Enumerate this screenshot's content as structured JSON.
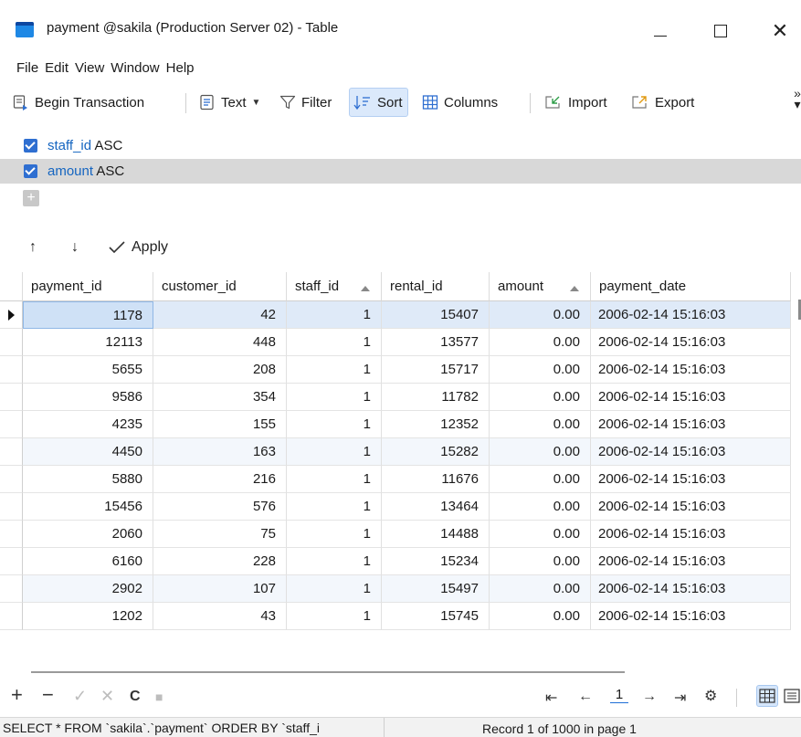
{
  "window": {
    "title": "payment @sakila (Production Server 02) - Table",
    "minimize": "—",
    "maximize": "",
    "close": "✕"
  },
  "menu": [
    "File",
    "Edit",
    "View",
    "Window",
    "Help"
  ],
  "toolbar": {
    "begin_transaction": "Begin Transaction",
    "text": "Text",
    "filter": "Filter",
    "sort": "Sort",
    "columns": "Columns",
    "import": "Import",
    "export": "Export",
    "overflow": "»"
  },
  "sort_panel": {
    "rules": [
      {
        "field": "staff_id",
        "direction": "ASC",
        "checked": true,
        "selected": false
      },
      {
        "field": "amount",
        "direction": "ASC",
        "checked": true,
        "selected": true
      }
    ],
    "add": "+",
    "move_up": "↑",
    "move_down": "↓",
    "apply_label": "Apply"
  },
  "grid": {
    "columns": [
      "payment_id",
      "customer_id",
      "staff_id",
      "rental_id",
      "amount",
      "payment_date"
    ],
    "sorted_columns": [
      "staff_id",
      "amount"
    ],
    "rows": [
      [
        "1178",
        "42",
        "1",
        "15407",
        "0.00",
        "2006-02-14 15:16:03"
      ],
      [
        "12113",
        "448",
        "1",
        "13577",
        "0.00",
        "2006-02-14 15:16:03"
      ],
      [
        "5655",
        "208",
        "1",
        "15717",
        "0.00",
        "2006-02-14 15:16:03"
      ],
      [
        "9586",
        "354",
        "1",
        "11782",
        "0.00",
        "2006-02-14 15:16:03"
      ],
      [
        "4235",
        "155",
        "1",
        "12352",
        "0.00",
        "2006-02-14 15:16:03"
      ],
      [
        "4450",
        "163",
        "1",
        "15282",
        "0.00",
        "2006-02-14 15:16:03"
      ],
      [
        "5880",
        "216",
        "1",
        "11676",
        "0.00",
        "2006-02-14 15:16:03"
      ],
      [
        "15456",
        "576",
        "1",
        "13464",
        "0.00",
        "2006-02-14 15:16:03"
      ],
      [
        "2060",
        "75",
        "1",
        "14488",
        "0.00",
        "2006-02-14 15:16:03"
      ],
      [
        "6160",
        "228",
        "1",
        "15234",
        "0.00",
        "2006-02-14 15:16:03"
      ],
      [
        "2902",
        "107",
        "1",
        "15497",
        "0.00",
        "2006-02-14 15:16:03"
      ],
      [
        "1202",
        "43",
        "1",
        "15745",
        "0.00",
        "2006-02-14 15:16:03"
      ]
    ]
  },
  "bottom_toolbar": {
    "add": "+",
    "delete": "−",
    "apply": "✓",
    "discard": "✕",
    "refresh": "C",
    "stop": "■",
    "first": "⇤",
    "prev": "←",
    "page": "1",
    "next": "→",
    "last": "⇥",
    "settings": "⚙"
  },
  "status": {
    "sql": "SELECT * FROM `sakila`.`payment` ORDER BY `staff_i",
    "record": "Record 1 of 1000 in page 1"
  },
  "colors": {
    "accent": "#2f6fd1",
    "sort_field": "#1565c0",
    "selected_row": "#dfeaf8",
    "alt_row": "#f3f7fc"
  }
}
